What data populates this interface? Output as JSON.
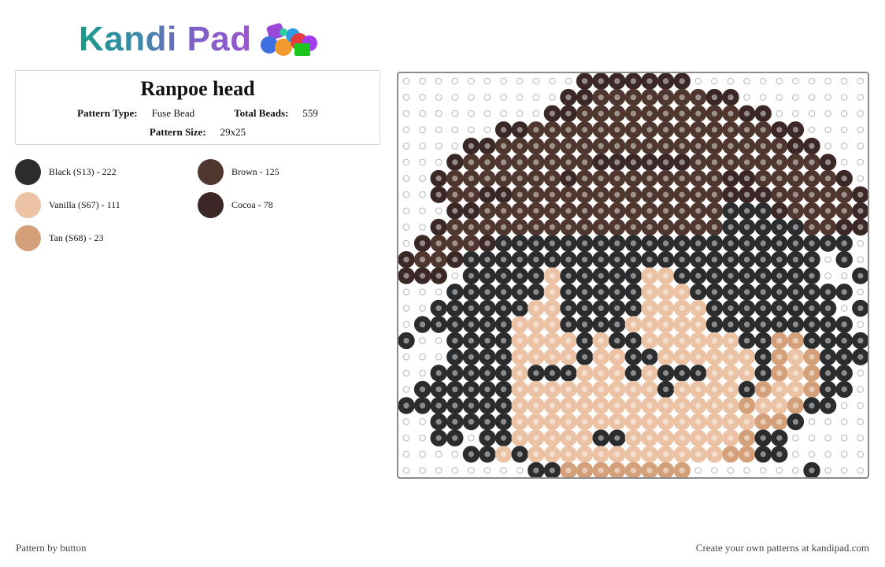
{
  "header": {
    "logo_text": "Kandi Pad",
    "logo_icon": "beads-cluster-icon"
  },
  "pattern": {
    "title": "Ranpoe head",
    "type_label": "Pattern Type:",
    "type_value": "Fuse Bead",
    "total_label": "Total Beads:",
    "total_value": "559",
    "size_label": "Pattern Size:",
    "size_value": "29x25"
  },
  "legend": [
    {
      "label": "Black (S13) - 222",
      "color": "#2a2c2e"
    },
    {
      "label": "Brown - 125",
      "color": "#4f362e"
    },
    {
      "label": "Vanilla (S67) - 111",
      "color": "#ebc2a4"
    },
    {
      "label": "Cocoa - 78",
      "color": "#3b2826"
    },
    {
      "label": "Tan (S68) - 23",
      "color": "#d4a07a"
    }
  ],
  "grid": {
    "cols": 29,
    "palette": {
      "K": "#2a2c2e",
      "B": "#4f362e",
      "V": "#ebc2a4",
      "C": "#3b2826",
      "T": "#d4a07a"
    },
    "rows": [
      "...........CCCCCCC...........",
      "..........CCBBBBBBBCC........",
      ".........CCBBBBBBBBBBCC......",
      "......CCBBBBBBBBBBBBBBBCC....",
      "....CCBBBBBBBBBBBBBBBBBBCC...",
      "...CBBBBBBBBCCCCCCBBBBBBBBC..",
      "..CBBBBBBBCBBBBBBBBBCCBBBBBC.",
      "..CBBCCBBBBBBBBBBBBBCCCBBBBBC",
      "...CCBBBBBBBBBBBBBBBKKKCBBBBC",
      "..CBBBBBBBBBBBBBBBBBKKKKKBBCC",
      ".CBBBCKKKKKKKKKKKKKKKKKKKKKK.",
      "CBBCKKKKKKKKKKKKKKKKKKKKKK.K.",
      "CCC.KKKKKVKKKKKVVKKKKKKKKK..K",
      "...KKKKKKVKKKKKVVVKKKKKKKKKK.",
      "..KKKKKKVVKKKKKVVVVKKKKKKKK.K",
      ".KKKKKKVVVKKKKVVVVVKKKKKKKKK.",
      "K..KKKKVVVVKVKKVVVVVVKKTTKKKK",
      "...KKKKVVVVKVVKKVVVVVVKTVTKKK",
      "..KKKKKVKKKVVVKVKKKVVVKTVTKK.",
      ".KKKKKKVVVVVVVVVKVVVVKTVVTKK.",
      "KKKKKKKVVVVVVVVVVVVVVTVVTKK..",
      "..KKKKKVVVVVVVVVVVVVVVTTK....",
      "..KK.KKVVVVVKKVVVVVVVTKK.....",
      "....KKVKVVVVVVVVVVVVTTKK.....",
      "........KKTTTTTTTT.......K..."
    ]
  }
}
